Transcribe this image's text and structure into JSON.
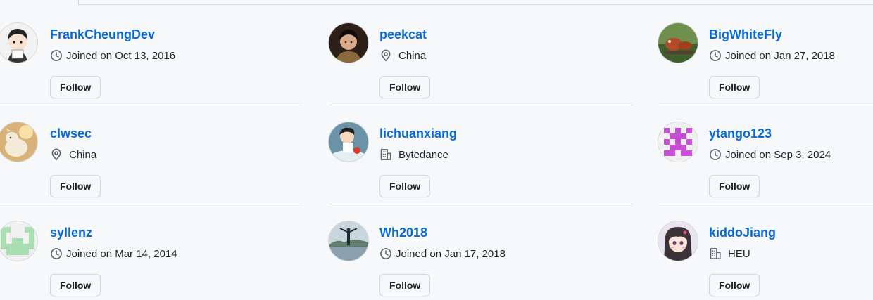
{
  "users": [
    {
      "username": "FrankCheungDev",
      "meta_type": "joined",
      "meta_icon": "clock-icon",
      "meta": "Joined on Oct 13, 2016",
      "follow_label": "Follow"
    },
    {
      "username": "peekcat",
      "meta_type": "location",
      "meta_icon": "location-icon",
      "meta": "China",
      "follow_label": "Follow"
    },
    {
      "username": "BigWhiteFly",
      "meta_type": "joined",
      "meta_icon": "clock-icon",
      "meta": "Joined on Jan 27, 2018",
      "follow_label": "Follow"
    },
    {
      "username": "clwsec",
      "meta_type": "location",
      "meta_icon": "location-icon",
      "meta": "China",
      "follow_label": "Follow"
    },
    {
      "username": "lichuanxiang",
      "meta_type": "company",
      "meta_icon": "organization-icon",
      "meta": "Bytedance",
      "follow_label": "Follow"
    },
    {
      "username": "ytango123",
      "meta_type": "joined",
      "meta_icon": "clock-icon",
      "meta": "Joined on Sep 3, 2024",
      "follow_label": "Follow"
    },
    {
      "username": "syllenz",
      "meta_type": "joined",
      "meta_icon": "clock-icon",
      "meta": "Joined on Mar 14, 2014",
      "follow_label": "Follow"
    },
    {
      "username": "Wh2018",
      "meta_type": "joined",
      "meta_icon": "clock-icon",
      "meta": "Joined on Jan 17, 2018",
      "follow_label": "Follow"
    },
    {
      "username": "kiddoJiang",
      "meta_type": "company",
      "meta_icon": "organization-icon",
      "meta": "HEU",
      "follow_label": "Follow"
    }
  ],
  "colors": {
    "link": "#0969da",
    "text": "#1f2328",
    "border": "#d0d7de",
    "background": "#f6f8fa",
    "identicon_purple": "#c74fd6",
    "identicon_green": "#a8deb1"
  }
}
